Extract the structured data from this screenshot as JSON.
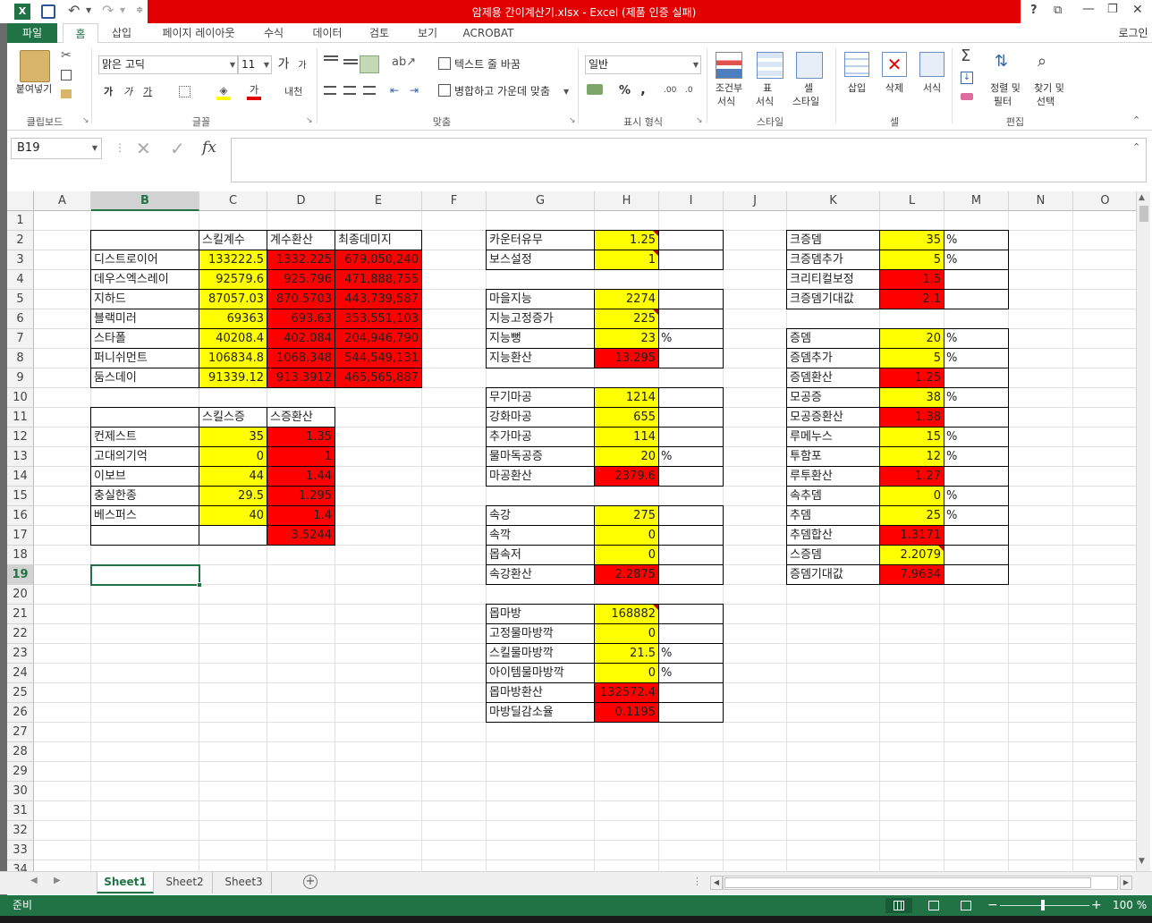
{
  "window": {
    "title": "암제용 간이계산기.xlsx -  Excel (제품 인증 실패)",
    "controls": [
      "?",
      "⧉",
      "—",
      "❐",
      "✕"
    ]
  },
  "menu": {
    "tabs": [
      "파일",
      "홈",
      "삽입",
      "페이지 레이아웃",
      "수식",
      "데이터",
      "검토",
      "보기",
      "ACROBAT"
    ],
    "active": "홈",
    "login": "로그인"
  },
  "ribbon": {
    "clipboard": {
      "paste": "붙여넣기",
      "label": "클립보드"
    },
    "font": {
      "name": "맑은 고딕",
      "size": "11",
      "label": "글꼴",
      "bold": "가",
      "italic": "가",
      "underline": "가",
      "grow": "가",
      "shrink": "가",
      "fontcolor": "가"
    },
    "align": {
      "wrap": "텍스트 줄 바꿈",
      "merge": "병합하고 가운데 맞춤",
      "label": "맞춤"
    },
    "number": {
      "format": "일반",
      "label": "표시 형식",
      "pct": "%",
      "comma": ","
    },
    "styles": {
      "cond1": "조건부",
      "cond2": "서식",
      "table1": "표",
      "table2": "서식",
      "cell1": "셀",
      "cell2": "스타일",
      "label": "스타일"
    },
    "cells": {
      "insert": "삽입",
      "delete": "삭제",
      "format": "서식",
      "label": "셀"
    },
    "editing": {
      "sort1": "정렬 및",
      "sort2": "필터",
      "find1": "찾기 및",
      "find2": "선택",
      "label": "편집"
    }
  },
  "formula_bar": {
    "name_box": "B19",
    "fx": "fx",
    "value": ""
  },
  "columns": [
    "A",
    "B",
    "C",
    "D",
    "E",
    "F",
    "G",
    "H",
    "I",
    "J",
    "K",
    "L",
    "M",
    "N",
    "O"
  ],
  "rows": [
    "1",
    "2",
    "3",
    "4",
    "5",
    "6",
    "7",
    "8",
    "9",
    "10",
    "11",
    "12",
    "13",
    "14",
    "15",
    "16",
    "17",
    "18",
    "19",
    "20",
    "21",
    "22",
    "23",
    "24",
    "25",
    "26",
    "27",
    "28",
    "29",
    "30",
    "31",
    "32",
    "33",
    "34"
  ],
  "cells": {
    "B2": "",
    "C2": "스킬계수",
    "D2": "계수환산",
    "E2": "최종데미지",
    "B3": "디스트로이어",
    "C3": "133222.5",
    "D3": "1332.225",
    "E3": "679,050,240",
    "B4": "데우스엑스레이",
    "C4": "92579.6",
    "D4": "925.796",
    "E4": "471,888,755",
    "B5": "지하드",
    "C5": "87057.03",
    "D5": "870.5703",
    "E5": "443,739,587",
    "B6": "블랙미러",
    "C6": "69363",
    "D6": "693.63",
    "E6": "353,551,103",
    "B7": "스타폴",
    "C7": "40208.4",
    "D7": "402.084",
    "E7": "204,946,790",
    "B8": "퍼니쉬먼트",
    "C8": "106834.8",
    "D8": "1068.348",
    "E8": "544,549,131",
    "B9": "둠스데이",
    "C9": "91339.12",
    "D9": "913.3912",
    "E9": "465,565,887",
    "B11": "",
    "C11": "스킬스증",
    "D11": "스증환산",
    "B12": "컨제스트",
    "C12": "35",
    "D12": "1.35",
    "B13": "고대의기억",
    "C13": "0",
    "D13": "1",
    "B14": "이보브",
    "C14": "44",
    "D14": "1.44",
    "B15": "충실한종",
    "C15": "29.5",
    "D15": "1.295",
    "B16": "베스퍼스",
    "C16": "40",
    "D16": "1.4",
    "B17": "",
    "C17": "",
    "D17": "3.5244",
    "G2": "카운터유무",
    "H2": "1.25",
    "G3": "보스설정",
    "H3": "1",
    "G5": "마을지능",
    "H5": "2274",
    "G6": "지능고정증가",
    "H6": "225",
    "G7": "지능뻥",
    "H7": "23",
    "I7": "%",
    "G8": "지능환산",
    "H8": "13.295",
    "G10": "무기마공",
    "H10": "1214",
    "G11": "강화마공",
    "H11": "655",
    "G12": "추가마공",
    "H12": "114",
    "G13": "물마독공증",
    "H13": "20",
    "I13": "%",
    "G14": "마공환산",
    "H14": "2379.6",
    "G16": "속강",
    "H16": "275",
    "G17": "속깍",
    "H17": "0",
    "G18": "몹속저",
    "H18": "0",
    "G19": "속강환산",
    "H19": "2.2875",
    "G21": "몹마방",
    "H21": "168882",
    "G22": "고정물마방깍",
    "H22": "0",
    "G23": "스킬물마방깍",
    "H23": "21.5",
    "I23": "%",
    "G24": "아이템물마방깍",
    "H24": "0",
    "I24": "%",
    "G25": "몹마방환산",
    "H25": "132572.4",
    "G26": "마방딜감소율",
    "H26": "0.1195",
    "K2": "크증뎀",
    "L2": "35",
    "M2": "%",
    "K3": "크증뎀추가",
    "L3": "5",
    "M3": "%",
    "K4": "크리티컬보정",
    "L4": "1.5",
    "K5": "크증뎀기대값",
    "L5": "2.1",
    "K7": "증뎀",
    "L7": "20",
    "M7": "%",
    "K8": "증뎀추가",
    "L8": "5",
    "M8": "%",
    "K9": "증뎀환산",
    "L9": "1.25",
    "K10": "모공증",
    "L10": "38",
    "M10": "%",
    "K11": "모공증환산",
    "L11": "1.38",
    "K12": "루메누스",
    "L12": "15",
    "M12": "%",
    "K13": "투함포",
    "L13": "12",
    "M13": "%",
    "K14": "루투환산",
    "L14": "1.27",
    "K15": "속추뎀",
    "L15": "0",
    "M15": "%",
    "K16": "추뎀",
    "L16": "25",
    "M16": "%",
    "K17": "추뎀합산",
    "L17": "1.3171",
    "K18": "스증뎀",
    "L18": "2.2079",
    "K19": "증뎀기대값",
    "L19": "7.9634"
  },
  "sheets": [
    "Sheet1",
    "Sheet2",
    "Sheet3"
  ],
  "active_sheet": "Sheet1",
  "status": {
    "ready": "준비",
    "zoom": "100 %"
  },
  "colors": {
    "excel_green": "#217346",
    "title_red": "#e30000",
    "input_yellow": "#ffff00",
    "calc_red": "#ff0000"
  }
}
